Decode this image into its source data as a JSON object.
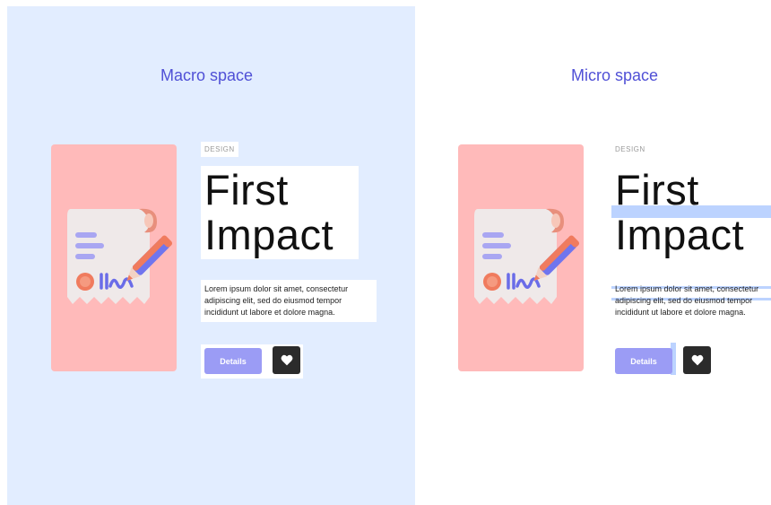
{
  "colors": {
    "macro_background": "#e2edff",
    "heading_accent": "#5050d6",
    "image_card": "#ffbaba",
    "button_primary": "#9b9cf5",
    "icon_button": "#2b2b2b",
    "spacing_guide": "#bcd3ff"
  },
  "macro": {
    "heading": "Macro space",
    "card": {
      "eyebrow": "DESIGN",
      "title_line1": "First",
      "title_line2": "Impact",
      "body": "Lorem ipsum dolor sit amet, consectetur adipiscing elit, sed do eiusmod tempor incididunt ut labore et dolore magna.",
      "details_label": "Details",
      "image_icon": "receipt-pencil-illustration",
      "favorite_icon": "heart-icon"
    }
  },
  "micro": {
    "heading": "Micro space",
    "card": {
      "eyebrow": "DESIGN",
      "title_line1": "First",
      "title_line2": "Impact",
      "body_line1": "Lorem ipsum dolor sit amet, consectetur",
      "body_line2": "adipiscing elit, sed do eiusmod tempor",
      "body_line3": "incididunt ut labore et dolore magna.",
      "details_label": "Details",
      "image_icon": "receipt-pencil-illustration",
      "favorite_icon": "heart-icon"
    }
  }
}
